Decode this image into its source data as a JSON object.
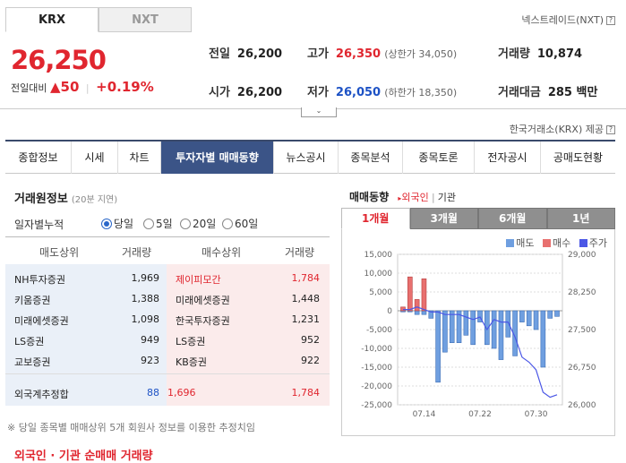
{
  "exchange_tabs": [
    "KRX",
    "NXT"
  ],
  "nxt_link": "넥스트레이드(NXT)",
  "price": "26,250",
  "change": {
    "label": "전일대비",
    "arrow": "▲",
    "amount": "50",
    "pct": "+0.19%"
  },
  "quotes": {
    "prev_close": {
      "label": "전일",
      "value": "26,200"
    },
    "high": {
      "label": "고가",
      "value": "26,350",
      "sub": "(상한가 34,050)"
    },
    "volume": {
      "label": "거래량",
      "value": "10,874"
    },
    "open": {
      "label": "시가",
      "value": "26,200"
    },
    "low": {
      "label": "저가",
      "value": "26,050",
      "sub": "(하한가 18,350)"
    },
    "amount": {
      "label": "거래대금",
      "value": "285 백만"
    }
  },
  "toggle_glyph": "⌄",
  "krx_note": "한국거래소(KRX) 제공",
  "nav_tabs": [
    "종합정보",
    "시세",
    "차트",
    "투자자별 매매동향",
    "뉴스공시",
    "종목분석",
    "종목토론",
    "전자공시",
    "공매도현황"
  ],
  "broker_section": {
    "title": "거래원정보",
    "delay": "(20분 지연)",
    "daily_label": "일자별누적",
    "radios": [
      "당일",
      "5일",
      "20일",
      "60일"
    ],
    "headers": {
      "sell": "매도상위",
      "sell_vol": "거래량",
      "buy": "매수상위",
      "buy_vol": "거래량"
    },
    "rows": [
      {
        "sell": "NH투자증권",
        "sell_vol": "1,969",
        "buy": "제이피모간",
        "buy_vol": "1,784"
      },
      {
        "sell": "키움증권",
        "sell_vol": "1,388",
        "buy": "미래에셋증권",
        "buy_vol": "1,448"
      },
      {
        "sell": "미래에셋증권",
        "sell_vol": "1,098",
        "buy": "한국투자증권",
        "buy_vol": "1,231"
      },
      {
        "sell": "LS증권",
        "sell_vol": "949",
        "buy": "LS증권",
        "buy_vol": "952"
      },
      {
        "sell": "교보증권",
        "sell_vol": "923",
        "buy": "KB증권",
        "buy_vol": "922"
      }
    ],
    "foreign": {
      "label": "외국계추정합",
      "sell": "88",
      "net": "1,696",
      "buy": "1,784"
    },
    "footnote": "※ 당일 종목별 매매상위 5개 회원사 정보를 이용한 추정치임"
  },
  "bottom_title": "외국인 · 기관 순매매 거래량",
  "trend": {
    "title": "매매동향",
    "links": [
      "외국인",
      "기관"
    ],
    "periods": [
      "1개월",
      "3개월",
      "6개월",
      "1년"
    ],
    "legend": [
      "매도",
      "매수",
      "주가"
    ]
  },
  "colors": {
    "up": "#e0262f",
    "down": "#1d52c5",
    "nav_active": "#3b5487",
    "sell_bar": "#6f9fe0",
    "buy_bar": "#e8706f",
    "price_line": "#4b57e6"
  },
  "chart_data": {
    "type": "bar",
    "x_ticks": [
      "07.14",
      "07.22",
      "07.30"
    ],
    "left_axis": {
      "ylim": [
        -25000,
        15000
      ],
      "ticks": [
        "15,000",
        "10,000",
        "5,000",
        "0",
        "-5,000",
        "-10,000",
        "-15,000",
        "-20,000",
        "-25,000"
      ]
    },
    "right_axis": {
      "ylim": [
        26000,
        29000
      ],
      "ticks": [
        "29,000",
        "28,250",
        "27,500",
        "26,750",
        "26,000"
      ]
    },
    "series": [
      {
        "name": "매도",
        "values": [
          -300,
          -300,
          -1000,
          -1000,
          -2000,
          -19000,
          -11000,
          -8500,
          -8500,
          -6500,
          -9000,
          -3000,
          -9000,
          -10000,
          -13000,
          -7000,
          -12000,
          -3000,
          -4000,
          -5000,
          -15000,
          -2000,
          -1500
        ]
      },
      {
        "name": "매수",
        "values": [
          1000,
          9000,
          3000,
          8500,
          0,
          0,
          0,
          0,
          0,
          0,
          0,
          0,
          0,
          0,
          0,
          0,
          0,
          0,
          0,
          0,
          0,
          0,
          0
        ]
      },
      {
        "name": "주가",
        "values": [
          27900,
          27900,
          27950,
          27900,
          27850,
          27850,
          27800,
          27800,
          27800,
          27750,
          27700,
          27750,
          27500,
          27700,
          27650,
          27650,
          27350,
          26950,
          26850,
          26700,
          26250,
          26150,
          26200
        ]
      }
    ]
  }
}
